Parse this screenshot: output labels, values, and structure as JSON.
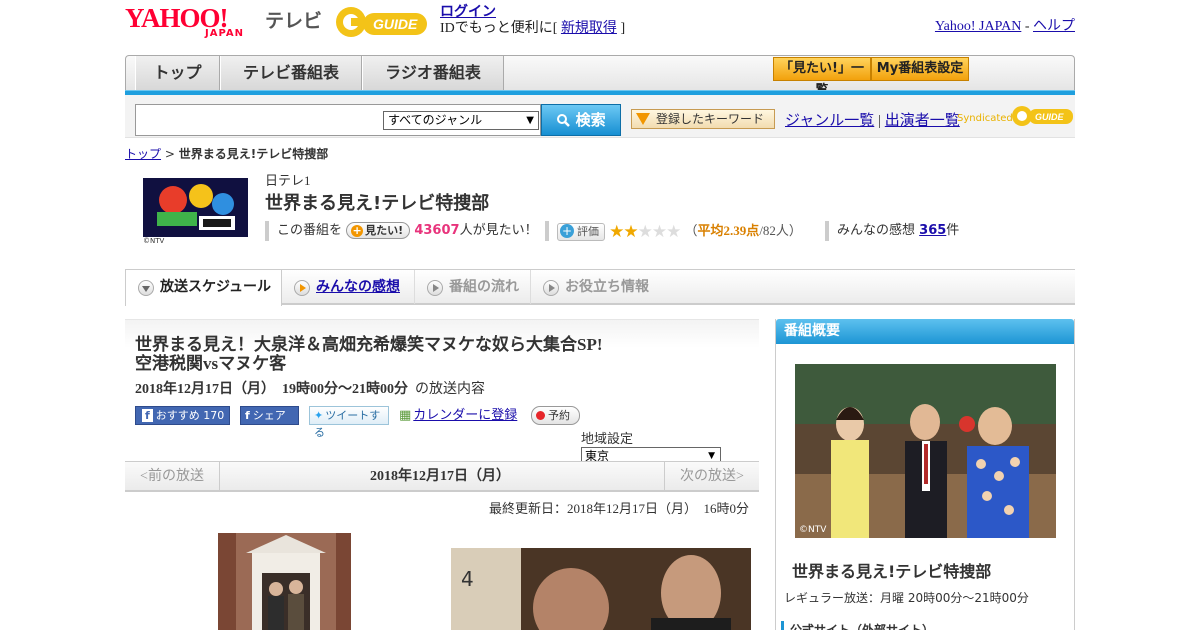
{
  "header": {
    "yahoo_logo": "YAHOO!",
    "yahoo_sub": "JAPAN",
    "tv_label": "テレビ",
    "gguide_logo": "G GUIDE",
    "login_link": "ログイン",
    "login_sub_prefix": "IDでもっと便利に[",
    "register_link": "新規取得",
    "login_sub_suffix": "]",
    "yahoo_japan_link": "Yahoo! JAPAN",
    "separator": "-",
    "help_link": "ヘルプ"
  },
  "nav": {
    "tabs": [
      {
        "label": "トップ"
      },
      {
        "label": "テレビ番組表"
      },
      {
        "label": "ラジオ番組表"
      }
    ],
    "mitai_list_btn": "「見たい!」一覧",
    "my_bangumi_btn": "My番組表設定"
  },
  "search": {
    "input_value": "",
    "genre_selected": "すべてのジャンル",
    "search_btn": "検索",
    "keyword_btn": "登録したキーワード",
    "genre_list_link": "ジャンル一覧",
    "link_sep": "|",
    "performer_link": "出演者一覧",
    "syndicated": "Syndicated"
  },
  "breadcrumb": {
    "top": "トップ",
    "sep": ">",
    "current": "世界まる見え!テレビ特捜部"
  },
  "program": {
    "thumb_note": "©NTV",
    "channel": "日テレ1",
    "title": "世界まる見え!テレビ特捜部",
    "mitai_prefix": "この番組を",
    "mitai_btn": "見たい!",
    "mitai_count": "43607",
    "mitai_suffix": "人が見たい！",
    "hyoka_btn": "評価",
    "rating": 2.39,
    "avg_prefix": "（",
    "avg_label": "平均2.39点",
    "avg_suffix": "/82人）",
    "kanso_prefix": "みんなの感想",
    "kanso_count": "365",
    "kanso_suffix": "件"
  },
  "ptabs": [
    {
      "label": "放送スケジュール"
    },
    {
      "label": "みんなの感想"
    },
    {
      "label": "番組の流れ"
    },
    {
      "label": "お役立ち情報"
    }
  ],
  "episode": {
    "title_line1": "世界まる見え！大泉洋＆高畑充希爆笑マヌケな奴ら大集合SP!",
    "title_line2": "空港税関vsマヌケ客",
    "date": "2018年12月17日（月）",
    "time": "19時00分～21時00分",
    "date_suffix": "の放送内容",
    "fb_recommend": "おすすめ 170",
    "fb_share": "シェア",
    "tweet": "ツイートする",
    "calendar": "カレンダーに登録",
    "reserve": "予約",
    "region_label": "地域設定",
    "region_value": "東京"
  },
  "pager": {
    "prev": "<前の放送",
    "current": "2018年12月17日（月）",
    "next": "次の放送>"
  },
  "updated": "最終更新日：2018年12月17日（月）　16時0分",
  "sidebar": {
    "head": "番組概要",
    "img_note": "©NTV",
    "title": "世界まる見え!テレビ特捜部",
    "regular": "レギュラー放送：月曜 20時00分～21時00分",
    "official": "公式サイト（外部サイト）"
  }
}
